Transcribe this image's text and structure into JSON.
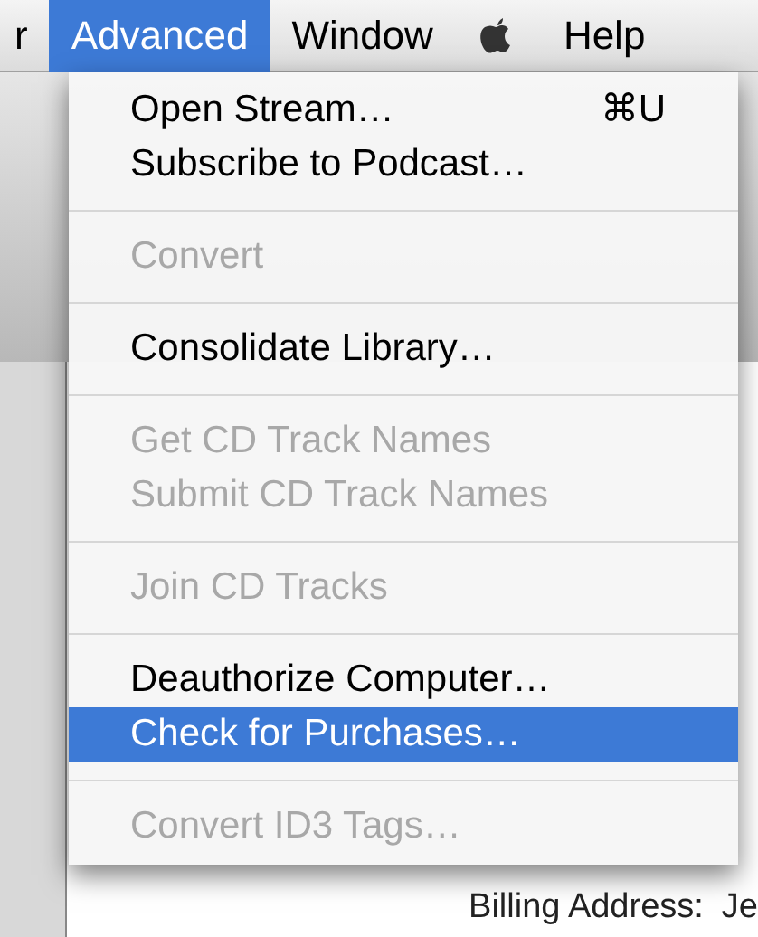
{
  "menu_bar": [
    {
      "label": "r",
      "selected": false
    },
    {
      "label": "Advanced",
      "selected": true
    },
    {
      "label": "Window",
      "selected": false
    },
    {
      "label": "Help",
      "selected": false
    }
  ],
  "menu": [
    {
      "kind": "item",
      "label": "Open Stream…",
      "shortcut": "⌘U",
      "disabled": false,
      "selected": false
    },
    {
      "kind": "item",
      "label": "Subscribe to Podcast…",
      "disabled": false,
      "selected": false
    },
    {
      "kind": "separator"
    },
    {
      "kind": "item",
      "label": "Convert",
      "disabled": true,
      "selected": false
    },
    {
      "kind": "separator"
    },
    {
      "kind": "item",
      "label": "Consolidate Library…",
      "disabled": false,
      "selected": false
    },
    {
      "kind": "separator"
    },
    {
      "kind": "item",
      "label": "Get CD Track Names",
      "disabled": true,
      "selected": false
    },
    {
      "kind": "item",
      "label": "Submit CD Track Names",
      "disabled": true,
      "selected": false
    },
    {
      "kind": "separator"
    },
    {
      "kind": "item",
      "label": "Join CD Tracks",
      "disabled": true,
      "selected": false
    },
    {
      "kind": "separator"
    },
    {
      "kind": "item",
      "label": "Deauthorize Computer…",
      "disabled": false,
      "selected": false
    },
    {
      "kind": "item",
      "label": "Check for Purchases…",
      "disabled": false,
      "selected": true
    },
    {
      "kind": "separator"
    },
    {
      "kind": "item",
      "label": "Convert ID3 Tags…",
      "disabled": true,
      "selected": false
    }
  ],
  "background": {
    "billing_label": "Billing Address:",
    "billing_value": "Je"
  }
}
